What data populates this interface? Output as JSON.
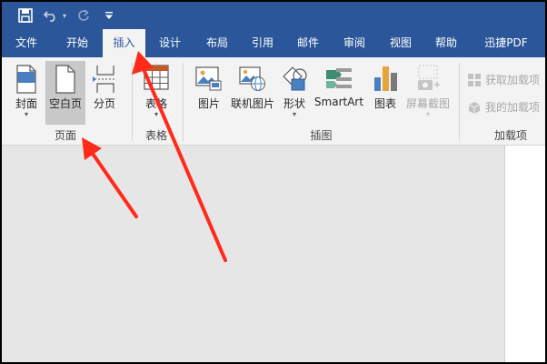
{
  "qat": {
    "save_icon": "save-icon",
    "undo_icon": "undo-icon",
    "redo_icon": "redo-icon",
    "customize_icon": "customize-qat-icon"
  },
  "tabs": [
    {
      "label": "文件"
    },
    {
      "label": "开始"
    },
    {
      "label": "插入"
    },
    {
      "label": "设计"
    },
    {
      "label": "布局"
    },
    {
      "label": "引用"
    },
    {
      "label": "邮件"
    },
    {
      "label": "审阅"
    },
    {
      "label": "视图"
    },
    {
      "label": "帮助"
    },
    {
      "label": "迅捷PDF"
    }
  ],
  "ribbon": {
    "pages": {
      "label": "页面",
      "cover": "封面",
      "blank": "空白页",
      "break": "分页"
    },
    "tables": {
      "label": "表格",
      "table": "表格"
    },
    "illustrations": {
      "label": "插图",
      "picture": "图片",
      "online_picture": "联机图片",
      "shapes": "形状",
      "smartart": "SmartArt",
      "chart": "图表",
      "screenshot": "屏幕截图"
    },
    "addins": {
      "label": "加载项",
      "get": "获取加载项",
      "mine": "我的加载项"
    }
  },
  "colors": {
    "titlebar": "#2b579a",
    "ribbon": "#f3f3f3",
    "document_bg": "#e6e6e6",
    "annotation_arrow": "#ff2a1a"
  }
}
